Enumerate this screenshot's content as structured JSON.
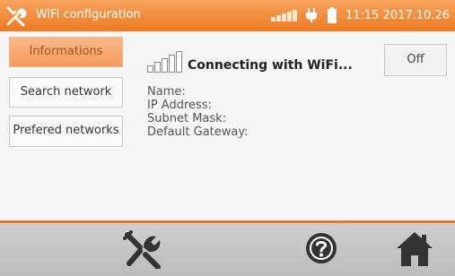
{
  "app": {
    "title": "WiFi configuration",
    "clock": "11:15 2017.10.26",
    "icons": {
      "app": "tools-icon",
      "signal": "signal-bars-icon",
      "power": "plug-icon",
      "battery": "battery-icon"
    },
    "colors": {
      "accent": "#ec7a22",
      "active_nav": "#f39a5d",
      "bottom_bar": "#c4c4c4"
    }
  },
  "nav": {
    "informations": "Informations",
    "search_network": "Search network",
    "prefered_networks": "Prefered networks"
  },
  "main": {
    "status": "Connecting with WiFi...",
    "toggle": "Off",
    "labels": {
      "name": "Name:",
      "ip": "IP Address:",
      "subnet": "Subnet Mask:",
      "gateway": "Default Gateway:"
    }
  },
  "bottom": {
    "icons": [
      "tools-icon",
      "help-icon",
      "home-icon"
    ]
  }
}
